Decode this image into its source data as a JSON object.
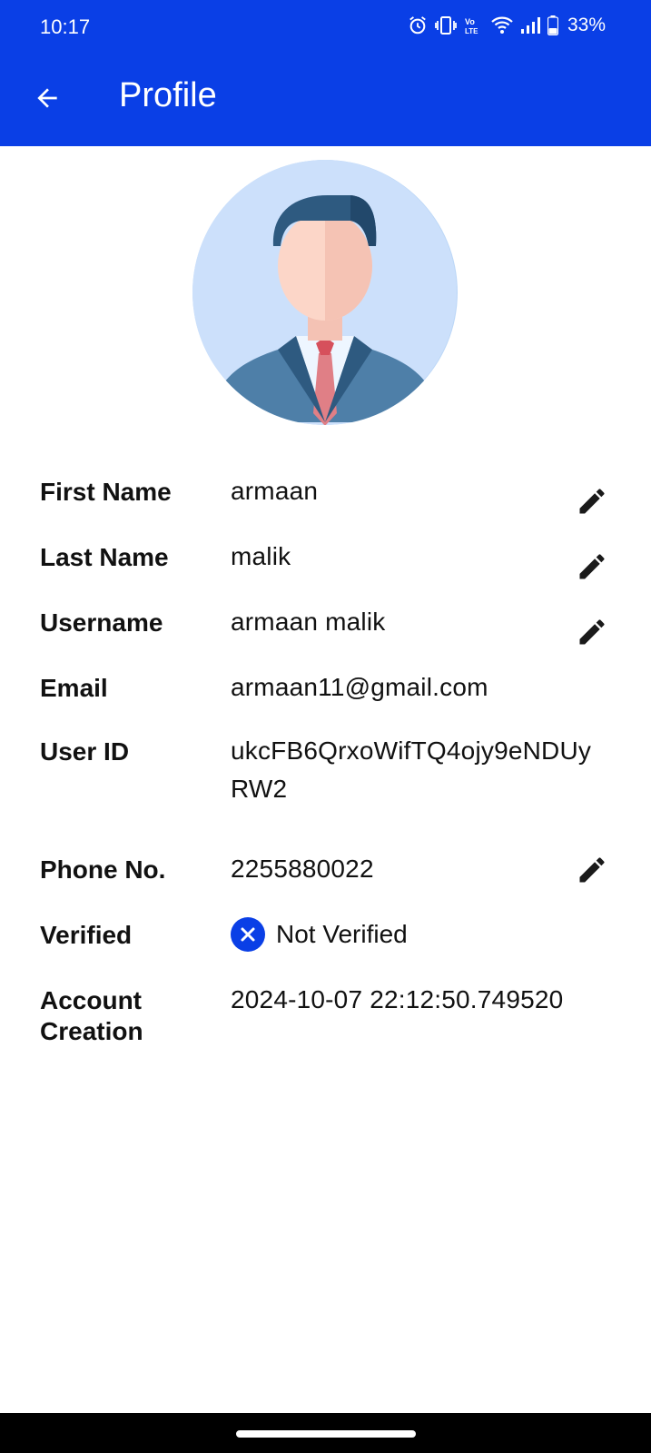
{
  "status_bar": {
    "time": "10:17",
    "battery": "33%",
    "icons": [
      "alarm-icon",
      "vibrate-icon",
      "volte-icon",
      "wifi-icon",
      "signal-icon",
      "battery-icon"
    ]
  },
  "appbar": {
    "title": "Profile",
    "back_icon": "arrow-left-icon",
    "color": "#0a3fe6"
  },
  "profile": {
    "avatar_icon": "user-avatar-illustration",
    "fields": {
      "first_name": {
        "label": "First Name",
        "value": "armaan",
        "editable": true
      },
      "last_name": {
        "label": "Last Name",
        "value": "malik",
        "editable": true
      },
      "username": {
        "label": "Username",
        "value": "armaan malik",
        "editable": true
      },
      "email": {
        "label": "Email",
        "value": "armaan11@gmail.com",
        "editable": false
      },
      "user_id": {
        "label": "User ID",
        "value_line1": "ukcFB6QrxoWifTQ4ojy9eNDUy",
        "value_line2": "RW2",
        "editable": false
      },
      "phone": {
        "label": "Phone No.",
        "value": "2255880022",
        "editable": true
      },
      "verified": {
        "label": "Verified",
        "value": "Not Verified",
        "icon": "x-circle-icon"
      },
      "account_creation": {
        "label_line1": "Account",
        "label_line2": "Creation",
        "value": "2024-10-07 22:12:50.749520"
      }
    },
    "edit_icon": "pencil-icon"
  }
}
